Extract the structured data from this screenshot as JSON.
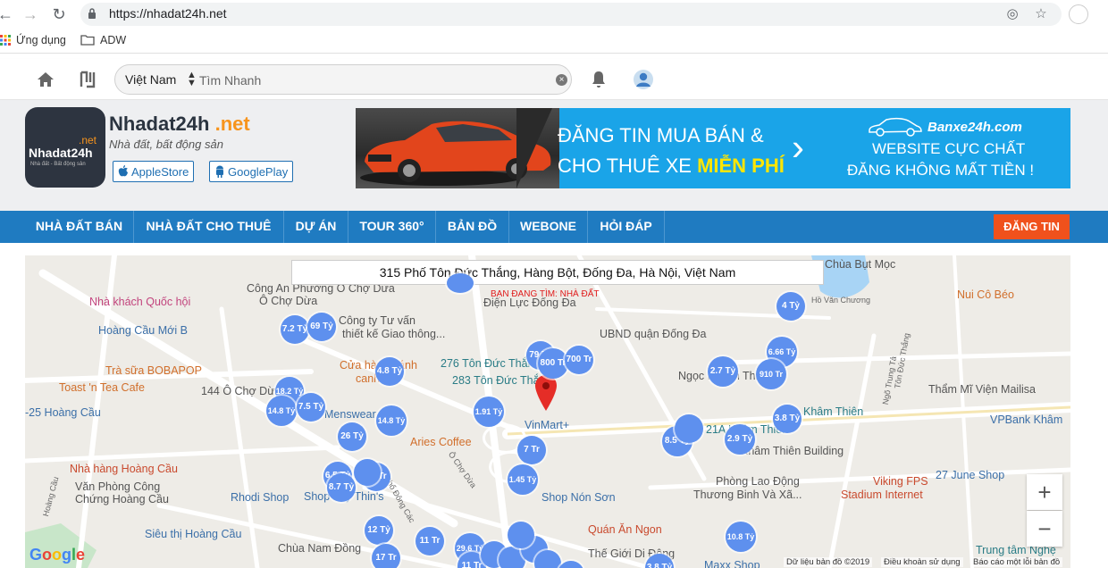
{
  "browser": {
    "url": "https://nhadat24h.net",
    "bookmarks": [
      {
        "label": "Ứng dụng",
        "icon": "apps-grid-icon"
      },
      {
        "label": "ADW",
        "icon": "folder-icon"
      }
    ]
  },
  "site": {
    "country": "Việt Nam",
    "search_placeholder": "Tìm Nhanh",
    "logo": {
      "net": ".net",
      "name": "Nhadat24h",
      "sub": "Nhà đất - Bất động sản"
    },
    "brand_name": "Nhadat24h",
    "brand_tld": ".net",
    "slogan": "Nhà đất, bất động sản",
    "apple_store": "AppleStore",
    "google_play": "GooglePlay",
    "banner": {
      "line1": "ĐĂNG TIN MUA BÁN &",
      "line2_prefix": "CHO THUÊ XE ",
      "line2_highlight": "MIỄN PHÍ",
      "brand": "Banxe24h.com",
      "right1": "WEBSITE CỰC CHẤT",
      "right2": "ĐĂNG KHÔNG MẤT TIỀN !"
    },
    "nav": [
      "NHÀ ĐẤT BÁN",
      "NHÀ ĐẤT CHO THUÊ",
      "DỰ ÁN",
      "TOUR 360°",
      "BẢN ĐỒ",
      "WEBONE",
      "HỎI ĐÁP"
    ],
    "post_button": "ĐĂNG TIN",
    "colors": {
      "nav_blue": "#1f7bc1",
      "post_orange": "#f0511c",
      "marker_blue": "#5e90ee",
      "brand_orange": "#f7941d"
    }
  },
  "map": {
    "address": "315 Phố Tôn Đức Thắng, Hàng Bột, Đống Đa, Hà Nội, Việt Nam",
    "searching_label": "BẠN ĐANG TÌM: NHÀ ĐẤT",
    "markers": [
      "4 Tỷ",
      "7.2 Tỷ",
      "69 Tỷ",
      "79 Tỷ",
      "800 Tr",
      "700 Tr",
      "6.66 Tỷ",
      "2.7 Tỷ",
      "910 Tr",
      "4.8 Tỷ",
      "18.2 Tỷ",
      "14.8 Tỷ",
      "7.5 Tỷ",
      "14.8 Tỷ",
      "1.91 Tỷ",
      "3.8 Tỷ",
      "26 Tỷ",
      "7 Tr",
      "8.5 Tỷ",
      "2.9 Tỷ",
      "6.5 Tỷ",
      "8.7 Tỷ",
      "10 Tr",
      "1.45 Tỷ",
      "12 Tỷ",
      "11 Tr",
      "17 Tr",
      "29.6 Tỷ",
      "11 Tr",
      "10.8 Tỷ",
      "3.8 Tỷ"
    ],
    "pois": {
      "p1": "Công An Phường Ô Chợ Dừa",
      "p1b": "Ô Chợ Dừa",
      "p2": "Nhà khách Quốc hội",
      "p3": "Hoàng Cầu Mới B",
      "p4": "Trà sữa BOBAPOP",
      "p5": "Toast 'n Tea Cafe",
      "p6": "144 Ô Chợ Dừa",
      "p7": "-25 Hoàng Cầu",
      "p8": "Menswear",
      "p9": "Cửa hàng bánh",
      "p9b": "canh 69",
      "p10": "Aries Coffee",
      "p11": "Nhà hàng Hoàng Cầu",
      "p12": "Văn Phòng Công",
      "p12b": "Chứng Hoàng Cầu",
      "p13": "Rhodi Shop",
      "p14": "Shop Thy Thin's",
      "p15": "Siêu thị Hoàng Cầu",
      "p16": "Chùa Nam Đồng",
      "p17": "Công ty Tư vấn",
      "p17b": "thiết kế Giao thông...",
      "p18": "276 Tôn Đức Thắng",
      "p19": "283 Tôn Đức Thắng",
      "p20": "Điện Lực Đống Đa",
      "p21": "UBND quận Đống Đa",
      "p22": "VinMart+",
      "p23": "Ngọc Khánh Thiên",
      "p24": "Shop Nón Sơn",
      "p25": "Quán Ăn Ngon",
      "p26": "Thế Giới Di Động",
      "p27": "Phòng Lao Động",
      "p27b": "Thương Binh Và Xã...",
      "p28": "Khâm Thiên Building",
      "p29": "Khâm Thiên",
      "p30": "21A Khâm Thiên",
      "p31": "Viking FPS",
      "p31b": "Stadium Internet",
      "p32": "27 June Shop",
      "p33": "Thẩm Mĩ Viện Mailisa",
      "p34": "VPBank Khâm",
      "p35": "Nui Cô Béo",
      "p36": "Hồ Văn Chương",
      "p37": "Chùa Bụt Mọc",
      "p38": "Trung tâm Nghệ",
      "p39": "Maxx Shop"
    },
    "streets": {
      "s1": "Ô Chợ Dừa",
      "s2": "Phố Đông Các",
      "s3": "Ngõ Trung Tả",
      "s4": "Hoàng Cầu",
      "s5": "Tôn Đức Thắng"
    },
    "footer": {
      "data": "Dữ liệu bản đồ ©2019",
      "terms": "Điều khoản sử dụng",
      "report": "Báo cáo một lỗi bản đồ"
    }
  }
}
